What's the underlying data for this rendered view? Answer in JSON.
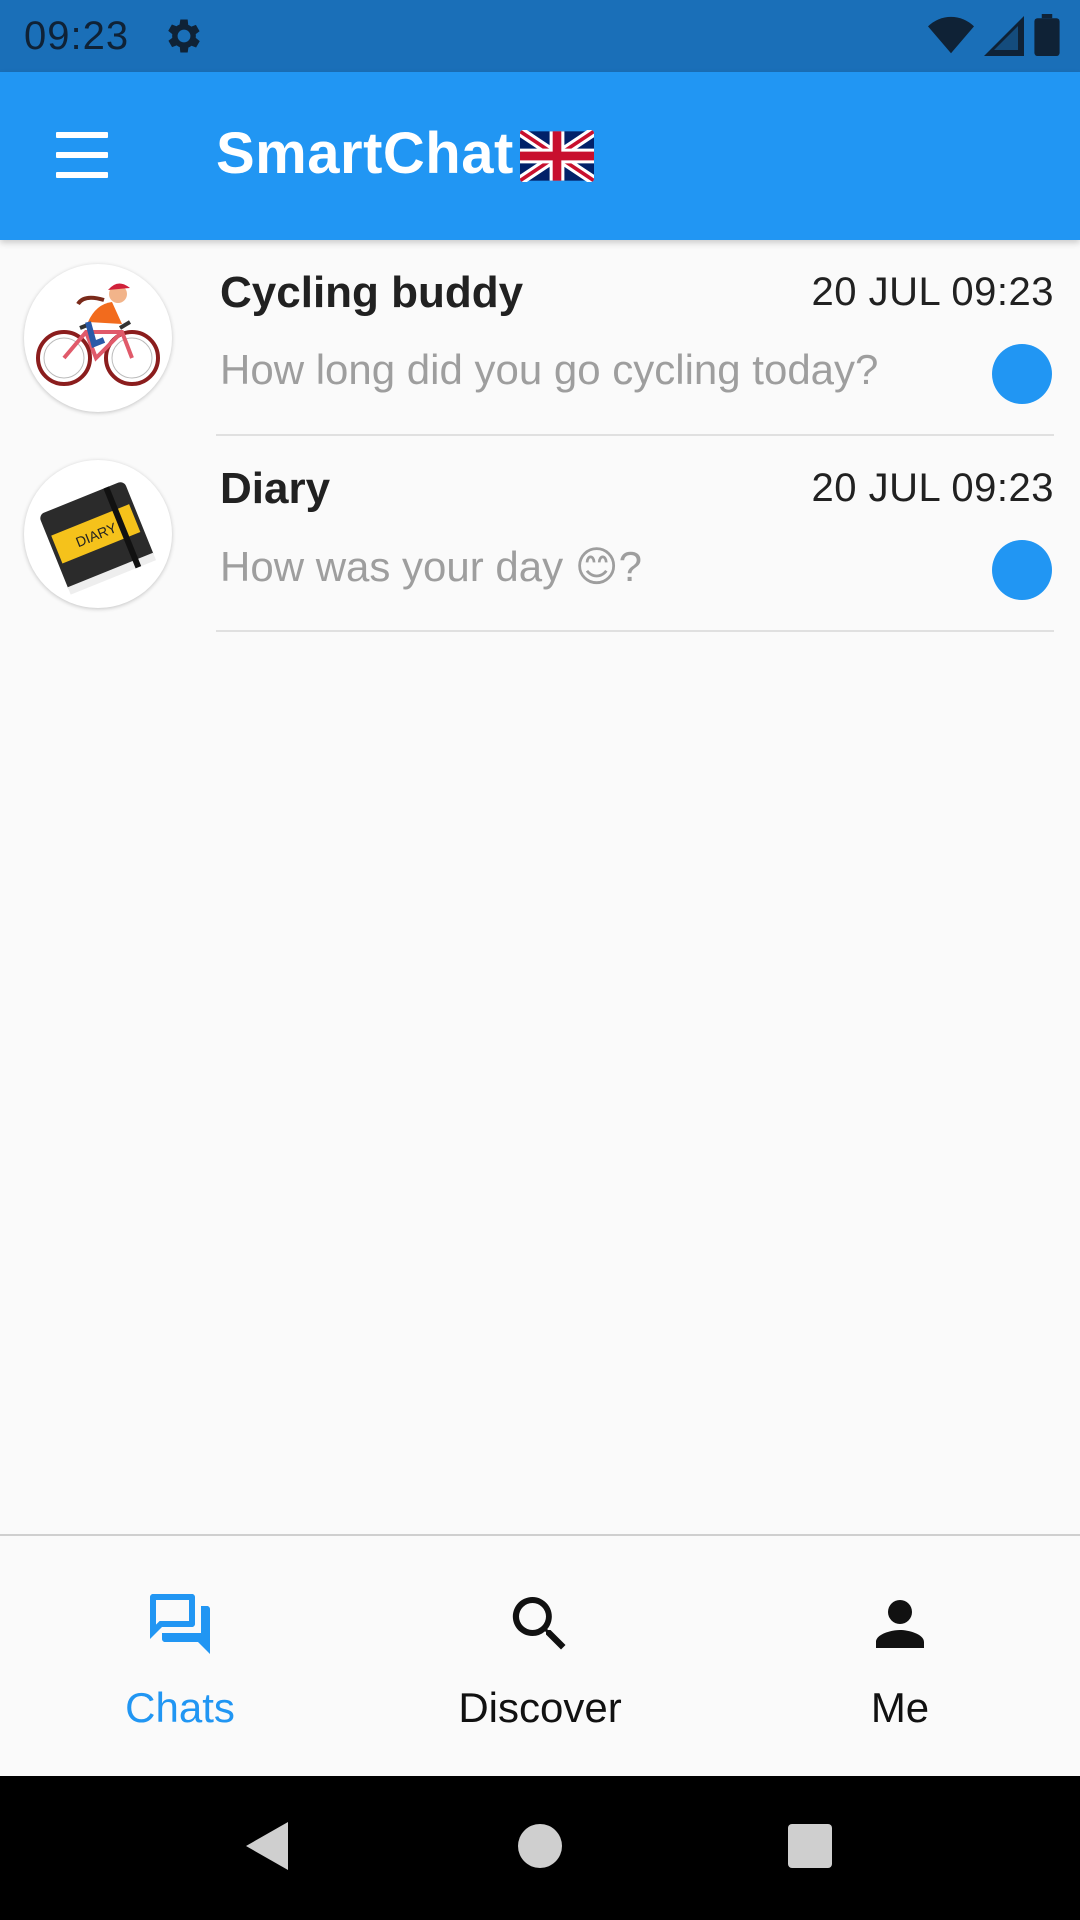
{
  "status_bar": {
    "time": "09:23",
    "icons": [
      "gear-icon",
      "wifi-icon",
      "signal-icon",
      "battery-icon"
    ]
  },
  "app_bar": {
    "title": "SmartChat",
    "menu_icon": "menu-icon",
    "flag_icon": "uk-flag-icon",
    "color": "#2196f3"
  },
  "chats": [
    {
      "name": "Cycling buddy",
      "time": "20 JUL 09:23",
      "preview": "How long did you go cycling today?",
      "avatar": "cyclist-avatar",
      "unread": true
    },
    {
      "name": "Diary",
      "time": "20 JUL 09:23",
      "preview": "How was your day 😊?",
      "avatar": "diary-book-avatar",
      "unread": true
    }
  ],
  "bottom_nav": {
    "items": [
      {
        "label": "Chats",
        "icon": "chat-bubbles-icon",
        "active": true
      },
      {
        "label": "Discover",
        "icon": "search-icon",
        "active": false
      },
      {
        "label": "Me",
        "icon": "person-icon",
        "active": false
      }
    ],
    "active_color": "#2196f3"
  },
  "system_nav": {
    "icons": [
      "back-icon",
      "home-icon",
      "recents-icon"
    ]
  }
}
